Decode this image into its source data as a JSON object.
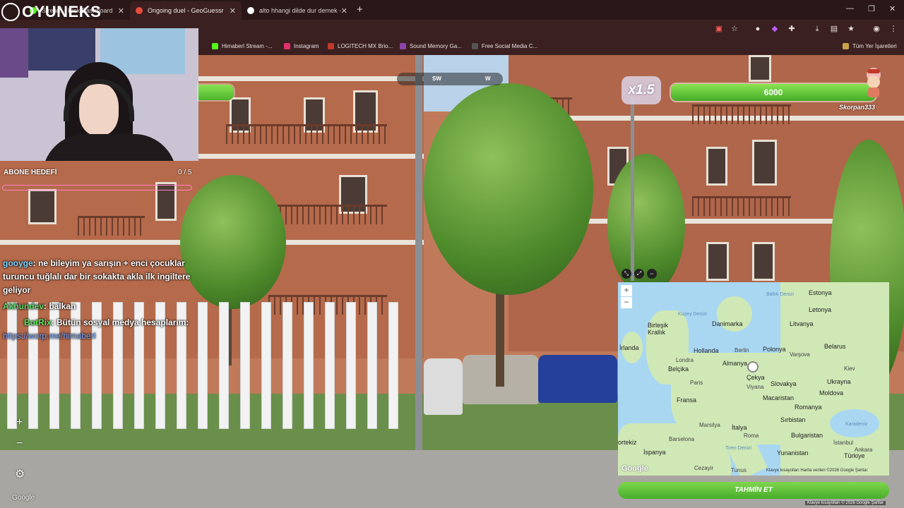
{
  "browser": {
    "tabs": [
      {
        "label": "Stream - Kick Dashboard",
        "active": false
      },
      {
        "label": "Ongoing duel - GeoGuessr",
        "active": true
      },
      {
        "label": "alto hhangi dilde dur demek -",
        "active": false
      }
    ],
    "new_tab_symbol": "+",
    "window_controls": {
      "minimize": "—",
      "maximize": "❐",
      "close": "✕"
    },
    "bookmarks": [
      {
        "label": "Himaberl Stream -...",
        "color": "#53fc18"
      },
      {
        "label": "Instagram",
        "color": "#e1306c"
      },
      {
        "label": "LOGITECH MX Brio...",
        "color": "#c0392b"
      },
      {
        "label": "Sound Memory Ga...",
        "color": "#8e44ad"
      },
      {
        "label": "Free Social Media C...",
        "color": "#333333"
      }
    ],
    "all_bookmarks": "Tüm Yer İşaretleri"
  },
  "overlay": {
    "logo": "OYUNEKS",
    "subgoal_label": "ABONE HEDEFİ",
    "subgoal_count": "0 / 5",
    "chat": [
      {
        "user": "gooyge",
        "text": ": ne bileyim ya sarışın + enci çocuklar turuncu tuğlalı dar bir sokakta akla ilk ingiltere geliyor"
      },
      {
        "user": "Akhundev",
        "text": ": balkan"
      },
      {
        "user": "BotRix",
        "text": ": Bütün sosyal medya hesaplarım:"
      },
      {
        "link": "https://worp.me/himaberl"
      }
    ]
  },
  "game": {
    "compass": {
      "left": "SW",
      "right": "W"
    },
    "multiplier": "x1.5",
    "opponent_health": "6000",
    "opponent_name": "Skorpan333",
    "map_labels": {
      "countries": [
        "Estonya",
        "Letonya",
        "Litvanya",
        "Danimarka",
        "Birleşik Krallık",
        "İrlanda",
        "Hollanda",
        "Polonya",
        "Belarus",
        "Belçika",
        "Almanya",
        "Çekya",
        "Slovakya",
        "Ukrayna",
        "Moldova",
        "Fransa",
        "Macaristan",
        "Romanya",
        "Sırbistan",
        "İtalya",
        "Bulgaristan",
        "İspanya",
        "Yunanistan",
        "Türkiye",
        "ortekiz"
      ],
      "cities": [
        "Berlin",
        "Varşova",
        "Kiev",
        "Londra",
        "Paris",
        "Viyana",
        "Marsilya",
        "Roma",
        "Barselona",
        "Ankara",
        "İstanbul",
        "Cezayir",
        "Tunus"
      ],
      "seas": [
        "Kuzey Denizi",
        "Baltık Denizi",
        "Karadeniz",
        "Tiren Denizi"
      ]
    },
    "map_footer": "Klavye kısayolları   Harita verileri ©2026 Google   Şartlar",
    "map_google": "Google",
    "guess_button": "TAHMİN ET",
    "streetview_google": "Google",
    "bottom_footer": "Klavye kısayolları   © 2026 Google   Şartlar"
  }
}
